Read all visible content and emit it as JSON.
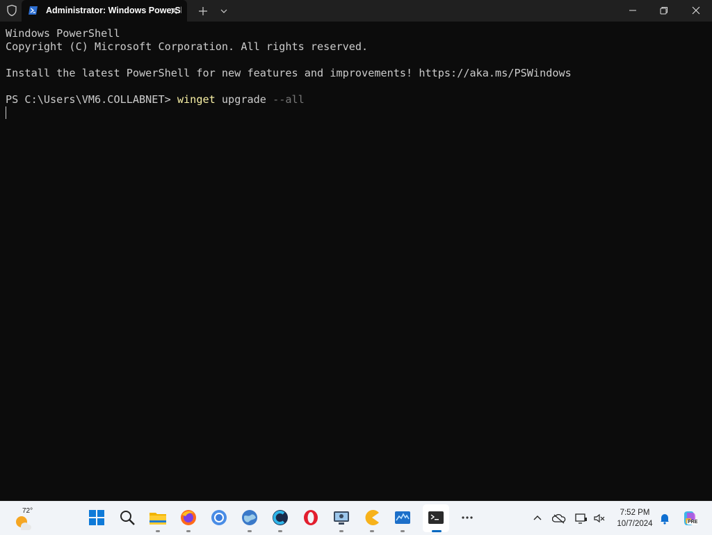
{
  "window": {
    "tab_title": "Administrator: Windows PowerShell",
    "icons": {
      "shield": "shield-icon",
      "tab": "powershell-icon",
      "close_tab": "close-icon",
      "new_tab": "plus-icon",
      "dropdown": "chevron-down-icon"
    },
    "controls": [
      "minimize",
      "maximize",
      "close"
    ]
  },
  "terminal": {
    "line1": "Windows PowerShell",
    "line2": "Copyright (C) Microsoft Corporation. All rights reserved.",
    "line3": "Install the latest PowerShell for new features and improvements! https://aka.ms/PSWindows",
    "prompt": "PS C:\\Users\\VM6.COLLABNET> ",
    "command": "winget",
    "argument": " upgrade ",
    "flag": "--all",
    "colors": {
      "background": "#0c0c0c",
      "text": "#cccccc",
      "command": "#f9f1a5",
      "flag": "#767676"
    }
  },
  "taskbar": {
    "weather_temp": "72°",
    "apps": [
      "start-icon",
      "search-icon",
      "file-explorer-icon",
      "firefox-icon",
      "chrome-icon",
      "globe-browser-icon",
      "ccleaner-icon",
      "opera-icon",
      "screen-capture-icon",
      "pacman-icon",
      "resource-monitor-icon",
      "terminal-icon",
      "more-icon"
    ],
    "tray": [
      "chevron-up-icon",
      "onedrive-icon",
      "display-icon",
      "network-speaker-icon"
    ],
    "time": "7:52 PM",
    "date": "10/7/2024",
    "copilot_badge": "PRE"
  }
}
